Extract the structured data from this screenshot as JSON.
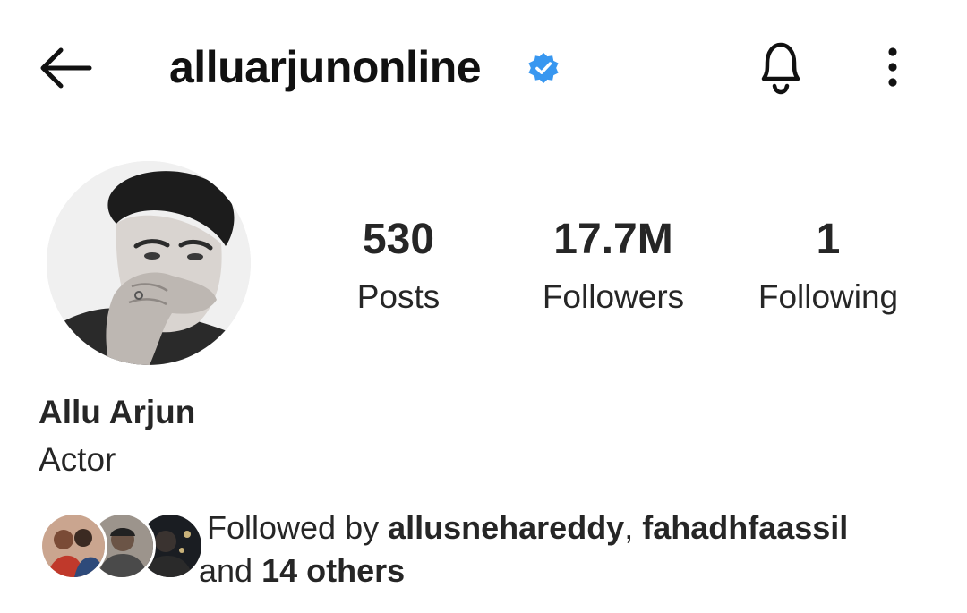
{
  "header": {
    "username": "alluarjunonline",
    "icons": {
      "back": "arrow-left-icon",
      "verified": "verified-badge-icon",
      "notifications": "bell-icon",
      "more": "more-vertical-icon"
    }
  },
  "colors": {
    "verified": "#3897f0",
    "text": "#262626"
  },
  "profile": {
    "stats": {
      "posts": {
        "value": "530",
        "label": "Posts"
      },
      "followers": {
        "value": "17.7M",
        "label": "Followers"
      },
      "following": {
        "value": "1",
        "label": "Following"
      }
    },
    "full_name": "Allu Arjun",
    "bio": "Actor"
  },
  "followed_by": {
    "prefix": "Followed by ",
    "user1": "allusnehareddy",
    "separator": ", ",
    "user2": "fahadhfaassil",
    "middle": " and ",
    "others": "14 others"
  }
}
